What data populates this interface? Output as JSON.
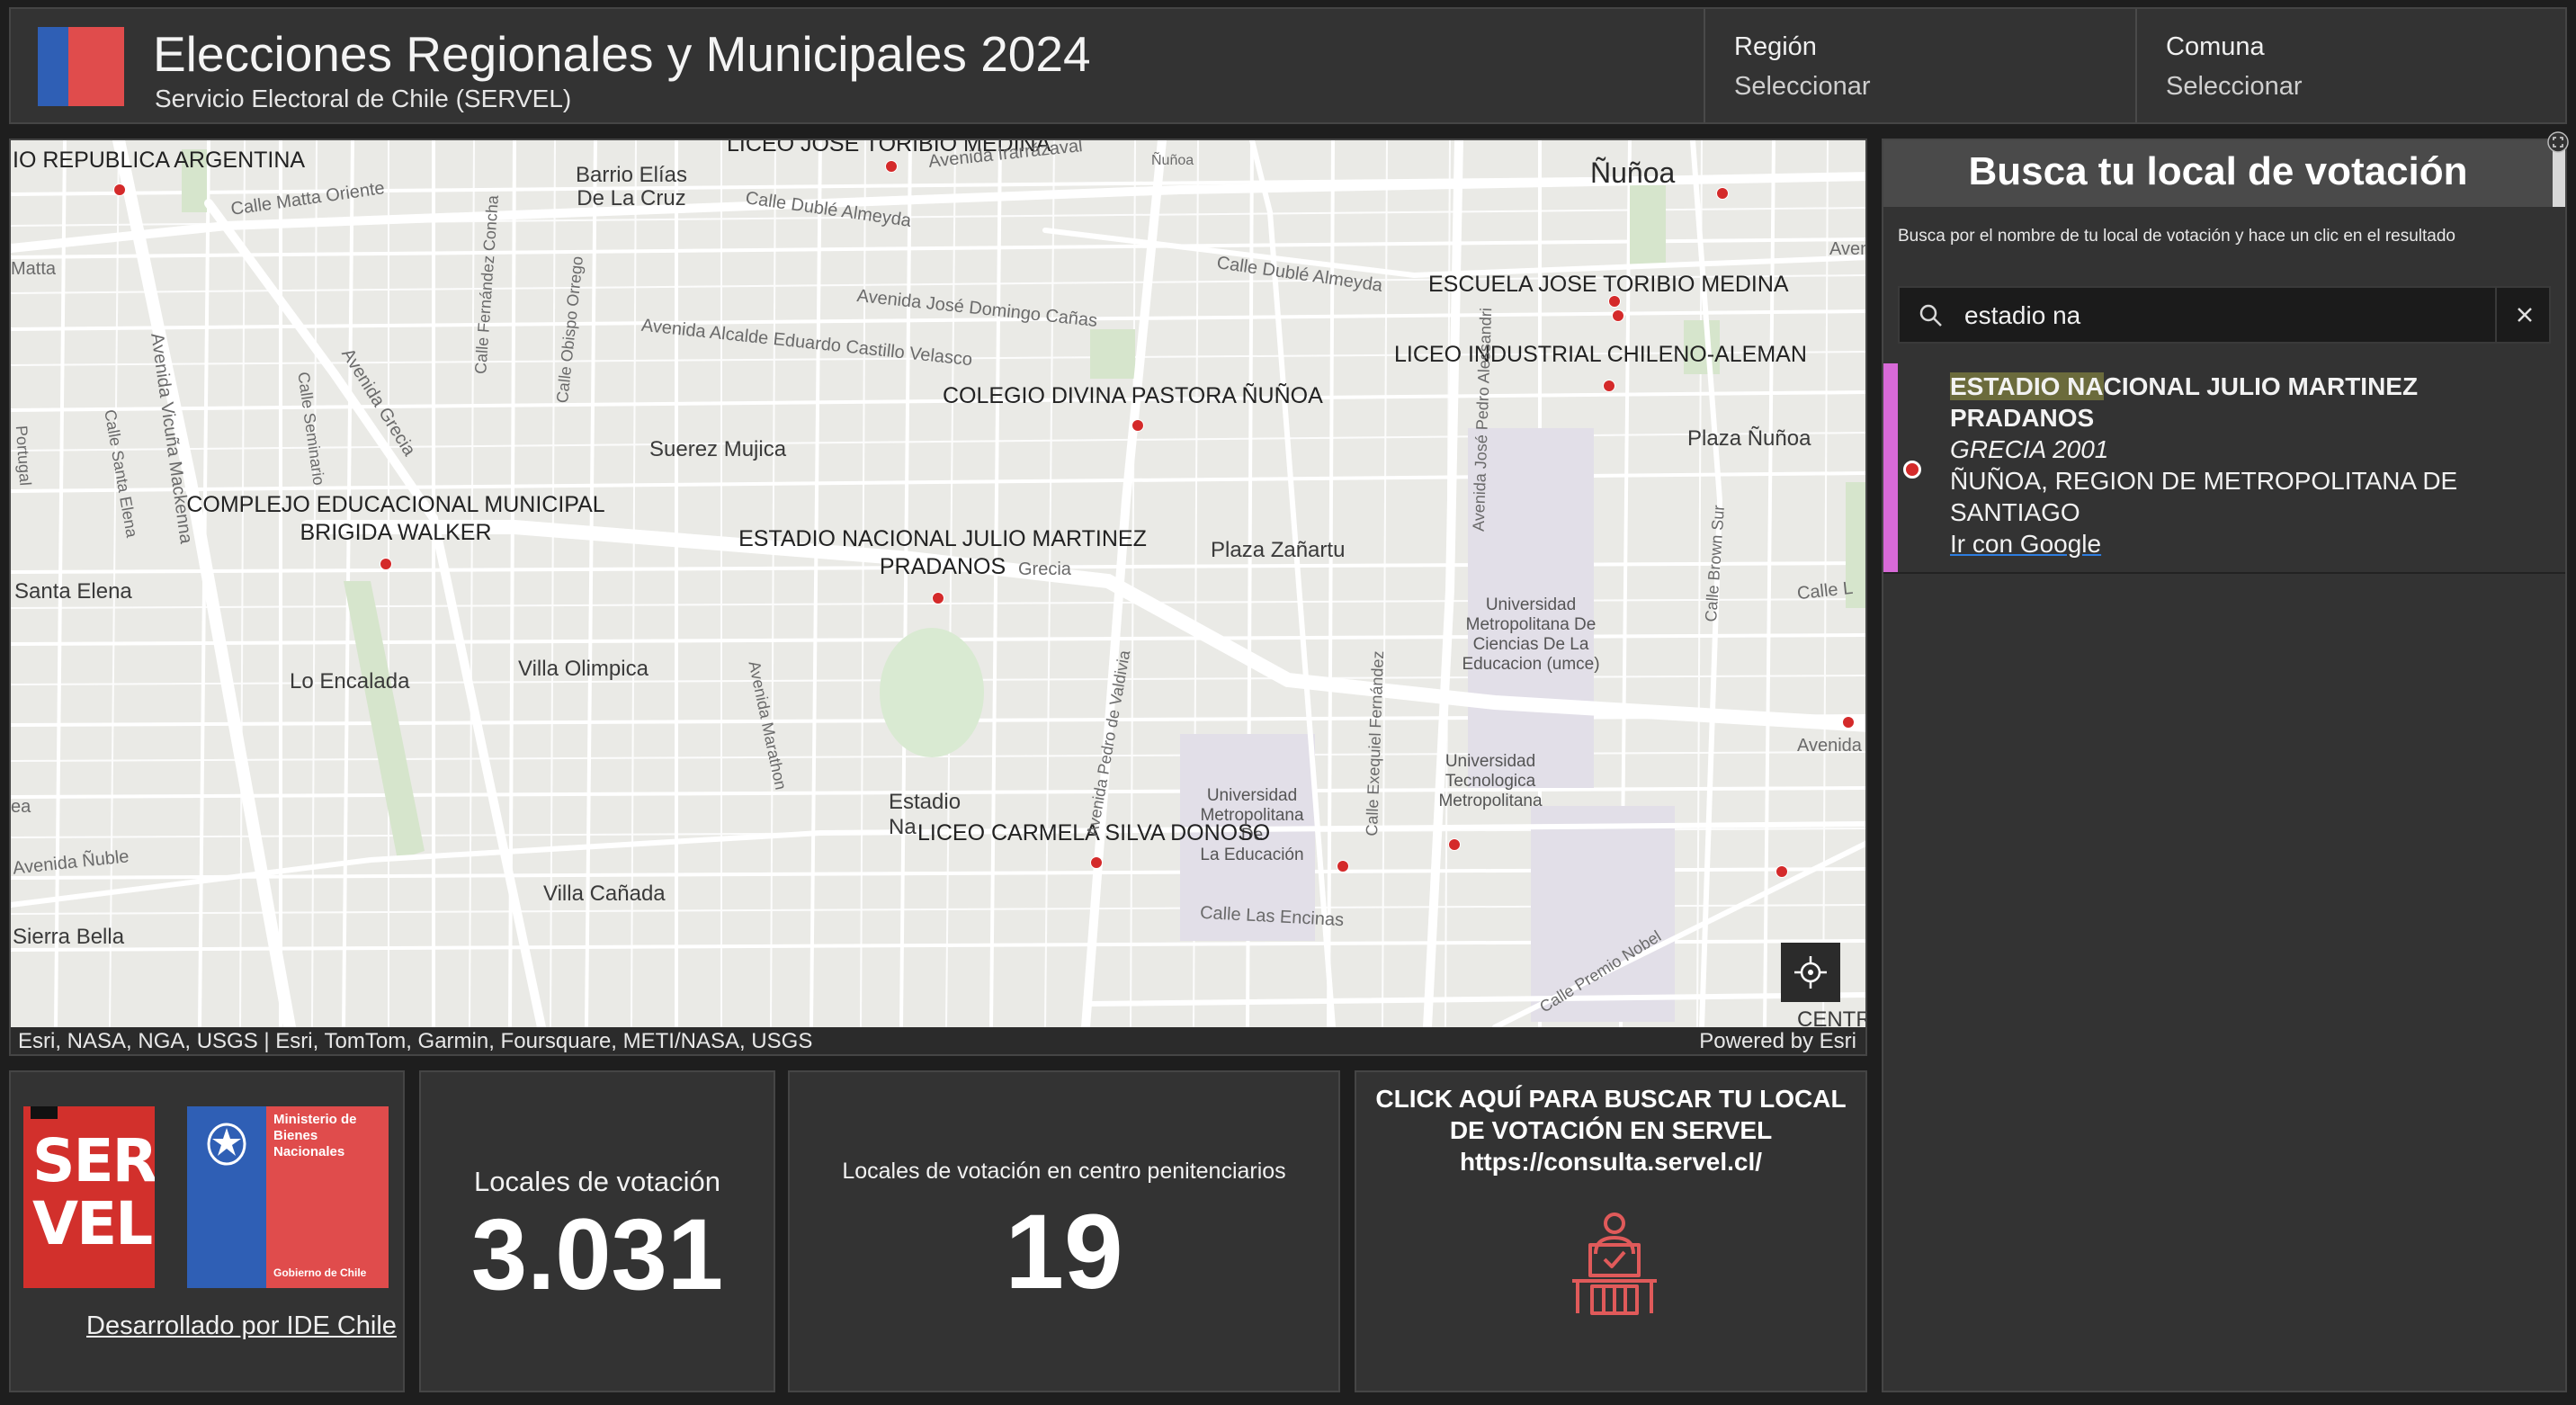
{
  "header": {
    "title": "Elecciones Regionales y Municipales 2024",
    "subtitle": "Servicio Electoral de Chile (SERVEL)",
    "region": {
      "label": "Región",
      "value": "Seleccionar"
    },
    "comuna": {
      "label": "Comuna",
      "value": "Seleccionar"
    }
  },
  "map": {
    "labels": {
      "republica": "IO REPUBLICA ARGENTINA",
      "barrio": "Barrio Elías\nDe La Cruz",
      "liceo_top": "LICEO JOSE TORIBIO MEDINA",
      "nunoa": "Ñuñoa",
      "escuela": "ESCUELA JOSE TORIBIO MEDINA",
      "liceo_ind": "LICEO INDUSTRIAL CHILENO-ALEMAN",
      "colegio": "COLEGIO DIVINA PASTORA ÑUÑOA",
      "plaza_nunoa": "Plaza Ñuñoa",
      "suerez": "Suerez Mujica",
      "complejo": "COMPLEJO EDUCACIONAL MUNICIPAL\nBRIGIDA WALKER",
      "estadio": "ESTADIO NACIONAL JULIO MARTINEZ\nPRADANOS",
      "plaza_zanartu": "Plaza Zañartu",
      "santa_elena": "Santa Elena",
      "lo_encalada": "Lo Encalada",
      "villa_olimpica": "Villa Olimpica",
      "umce": "Universidad\nMetropolitana De\nCiencias De La\nEducacion (umce)",
      "utem": "Universidad\nTecnologica\nMetropolitana",
      "univ_metro": "Universidad\nMetropolitana\nDe\nLa Educación",
      "estadio_nac": "Estadio\nNa",
      "liceo_carmela": "LICEO CARMELA SILVA DONOSO",
      "villa_canada": "Villa Cañada",
      "sierra_bella": "Sierra Bella",
      "centr": "CENTR"
    },
    "streets": {
      "matta_oriente": "Calle Matta Oriente",
      "duble1": "Calle Dublé Almeyda",
      "duble2": "Calle Dublé Almeyda",
      "irrazaval": "Avenida Irarrázaval",
      "nunoa_station": "Ñuñoa",
      "jose_domingo": "Avenida José Domingo Cañas",
      "alcalde": "Avenida Alcalde Eduardo Castillo Velasco",
      "vicuna": "Avenida Vicuña Mackenna",
      "santa_elena_st": "Calle Santa Elena",
      "seminario": "Calle Seminario",
      "fernandez": "Calle Fernández Concha",
      "obispo": "Calle Obispo Orrego",
      "grecia1": "Avenida Grecia",
      "grecia2": "Grecia",
      "grecia3": "Avenida",
      "jose_pedro": "Avenida José Pedro Alessandri",
      "brown": "Calle Brown Sur",
      "marathon": "Avenida Marathon",
      "valdivia": "Avenida Pedro de Valdivia",
      "exequiel": "Calle Exequiel Fernández",
      "encinas": "Calle Las Encinas",
      "nuble": "Avenida Ñuble",
      "premio": "Calle Premio Nobel",
      "matta": "Matta",
      "portugal": "Portugal",
      "aven": "Aven",
      "calle_r": "Calle L",
      "ea": "ea"
    },
    "attribution": "Esri, NASA, NGA, USGS | Esri, TomTom, Garmin, Foursquare, METI/NASA, USGS",
    "powered_by": "Powered by Esri"
  },
  "search": {
    "title": "Busca tu local de votación",
    "instruction": "Busca por el nombre de tu local de votación y hace un clic en el resultado",
    "query": "estadio na",
    "result": {
      "name_highlight": "ESTADIO NA",
      "name_rest": "CIONAL JULIO MARTINEZ PRADANOS",
      "address": "GRECIA 2001",
      "location": "ÑUÑOA, REGION DE METROPOLITANA DE SANTIAGO",
      "link": "Ir con Google"
    }
  },
  "footer": {
    "servel_logo_text": "SERVEL",
    "ministerio_logo_text": "Ministerio de Bienes Nacionales",
    "gobierno_text": "Gobierno de Chile",
    "developer_link": "Desarrollado por IDE Chile",
    "locales_label": "Locales de votación",
    "locales_value": "3.031",
    "penit_label": "Locales de votación en centro penitenciarios",
    "penit_value": "19",
    "cta_text": "CLICK AQUÍ PARA BUSCAR TU LOCAL DE VOTACIÓN EN SERVEL",
    "cta_url": "https://consulta.servel.cl/"
  },
  "colors": {
    "panel_bg": "#333333",
    "accent_red": "#d42a2a",
    "result_accent": "#d86ad8",
    "flag_blue": "#2f5fb5",
    "flag_red": "#e04c4c"
  },
  "icons": [
    "search-icon",
    "close-icon",
    "locate-icon",
    "voting-booth-icon",
    "expand-icon"
  ]
}
